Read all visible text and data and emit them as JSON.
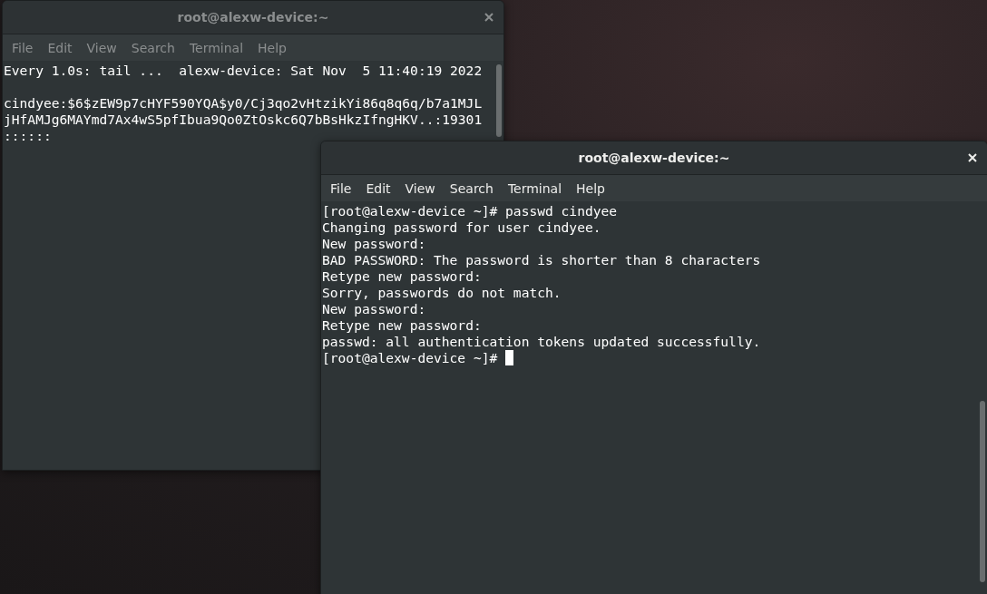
{
  "windows": [
    {
      "title": "root@alexw-device:~",
      "active": false,
      "menu": [
        "File",
        "Edit",
        "View",
        "Search",
        "Terminal",
        "Help"
      ],
      "header": "Every 1.0s: tail ...  alexw-device: Sat Nov  5 11:40:19 2022",
      "lines": [
        "cindyee:$6$zEW9p7cHYF590YQA$y0/Cj3qo2vHtzikYi86q8q6q/b7a1MJL",
        "jHfAMJg6MAYmd7Ax4wS5pfIbua9Qo0ZtOskc6Q7bBsHkzIfngHKV..:19301",
        ":::::: "
      ],
      "cursor": false
    },
    {
      "title": "root@alexw-device:~",
      "active": true,
      "menu": [
        "File",
        "Edit",
        "View",
        "Search",
        "Terminal",
        "Help"
      ],
      "lines": [
        "[root@alexw-device ~]# passwd cindyee",
        "Changing password for user cindyee.",
        "New password:",
        "BAD PASSWORD: The password is shorter than 8 characters",
        "Retype new password:",
        "Sorry, passwords do not match.",
        "New password:",
        "Retype new password:",
        "passwd: all authentication tokens updated successfully.",
        "[root@alexw-device ~]# "
      ],
      "cursor": true
    }
  ]
}
